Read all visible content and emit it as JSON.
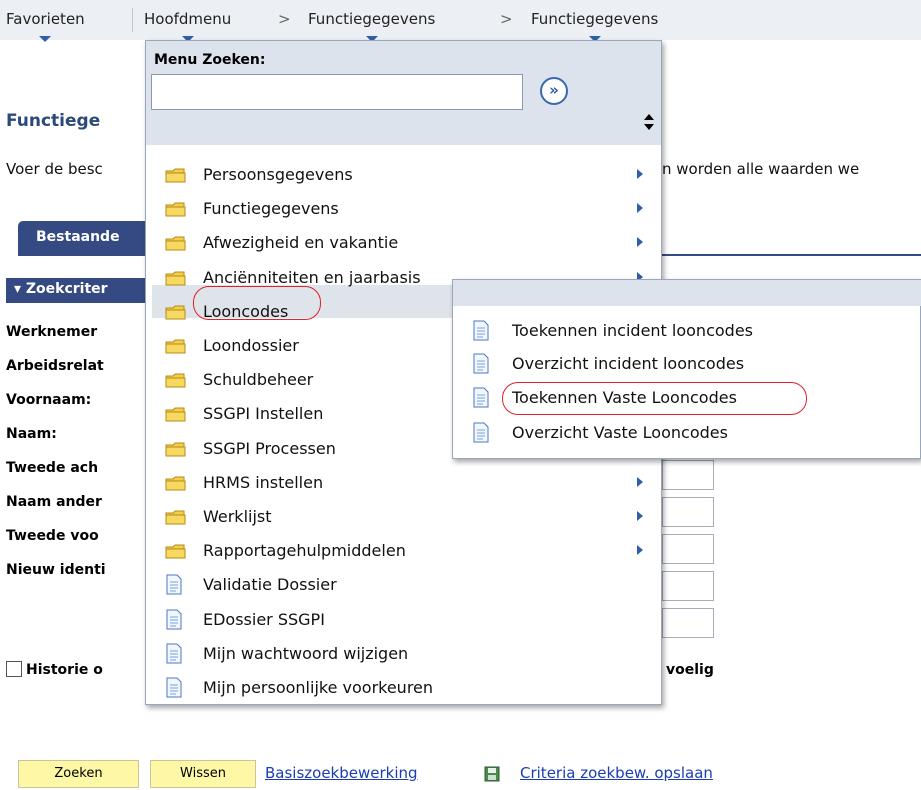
{
  "nav": {
    "favorites": "Favorieten",
    "main_menu": "Hoofdmenu",
    "sep": ">",
    "crumb1": "Functiegegevens",
    "crumb2": "Functiegegevens"
  },
  "page": {
    "title": "Functiege",
    "desc_left": "Voer de besc",
    "desc_right": "n worden alle waarden we",
    "tab_label": "Bestaande",
    "section_label": "Zoekcriter",
    "fields": [
      "Werknemer",
      "Arbeidsrelat",
      "Voornaam:",
      "Naam:",
      "Tweede ach",
      "Naam ander",
      "Tweede voo",
      "Nieuw identi"
    ],
    "history_label": "Historie o",
    "case_label": "voelig"
  },
  "actions": {
    "search_button": "Zoeken",
    "clear_button": "Wissen",
    "basic_search_link": "Basiszoekbewerking",
    "save_criteria_link": "Criteria zoekbew. opslaan"
  },
  "menu": {
    "search_label": "Menu Zoeken:",
    "search_value": "",
    "go_glyph": "»",
    "items": [
      {
        "label": "Persoonsgegevens",
        "type": "folder",
        "arrow": true
      },
      {
        "label": "Functiegegevens",
        "type": "folder",
        "arrow": true
      },
      {
        "label": "Afwezigheid en vakantie",
        "type": "folder",
        "arrow": true
      },
      {
        "label": "Anciënniteiten en jaarbasis",
        "type": "folder",
        "arrow": true
      },
      {
        "label": "Looncodes",
        "type": "folder",
        "arrow": false,
        "highlighted": true
      },
      {
        "label": "Loondossier",
        "type": "folder",
        "arrow": false
      },
      {
        "label": "Schuldbeheer",
        "type": "folder",
        "arrow": false
      },
      {
        "label": "SSGPI Instellen",
        "type": "folder",
        "arrow": false
      },
      {
        "label": "SSGPI Processen",
        "type": "folder",
        "arrow": false
      },
      {
        "label": "HRMS instellen",
        "type": "folder",
        "arrow": true
      },
      {
        "label": "Werklijst",
        "type": "folder",
        "arrow": true
      },
      {
        "label": "Rapportagehulpmiddelen",
        "type": "folder",
        "arrow": true
      },
      {
        "label": "Validatie Dossier",
        "type": "doc",
        "arrow": false
      },
      {
        "label": "EDossier SSGPI",
        "type": "doc",
        "arrow": false
      },
      {
        "label": "Mijn wachtwoord wijzigen",
        "type": "doc",
        "arrow": false
      },
      {
        "label": "Mijn persoonlijke voorkeuren",
        "type": "doc",
        "arrow": false
      }
    ]
  },
  "submenu": {
    "items": [
      "Toekennen incident looncodes",
      "Overzicht incident looncodes",
      "Toekennen Vaste Looncodes",
      "Overzicht Vaste Looncodes"
    ]
  },
  "colors": {
    "nav_bg": "#eceff3",
    "title_blue": "#2b4a7b",
    "tab_blue": "#354a82",
    "menu_header": "#dde3ed",
    "highlight": "#dfe4ea",
    "annotation_red": "#e0202a",
    "button_yellow": "#fdf7a6",
    "link_blue": "#1a3db3"
  },
  "icons": [
    "folder-icon",
    "document-icon",
    "submenu-arrow-icon",
    "sort-icon",
    "go-arrow-icon",
    "save-icon"
  ]
}
